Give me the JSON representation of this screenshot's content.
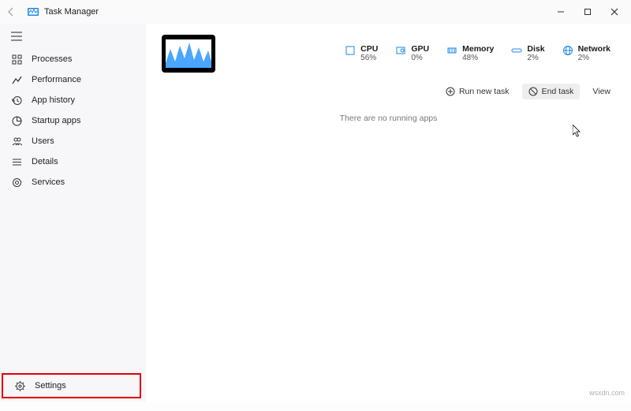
{
  "window": {
    "title": "Task Manager"
  },
  "sidebar": {
    "items": [
      {
        "label": "Processes"
      },
      {
        "label": "Performance"
      },
      {
        "label": "App history"
      },
      {
        "label": "Startup apps"
      },
      {
        "label": "Users"
      },
      {
        "label": "Details"
      },
      {
        "label": "Services"
      }
    ],
    "settings": "Settings"
  },
  "metrics": [
    {
      "label": "CPU",
      "value": "56%"
    },
    {
      "label": "GPU",
      "value": "0%"
    },
    {
      "label": "Memory",
      "value": "48%"
    },
    {
      "label": "Disk",
      "value": "2%"
    },
    {
      "label": "Network",
      "value": "2%"
    }
  ],
  "toolbar": {
    "run_new_task": "Run new task",
    "end_task": "End task",
    "view": "View"
  },
  "content": {
    "empty_message": "There are no running apps"
  },
  "watermark": "wsxdn.com"
}
